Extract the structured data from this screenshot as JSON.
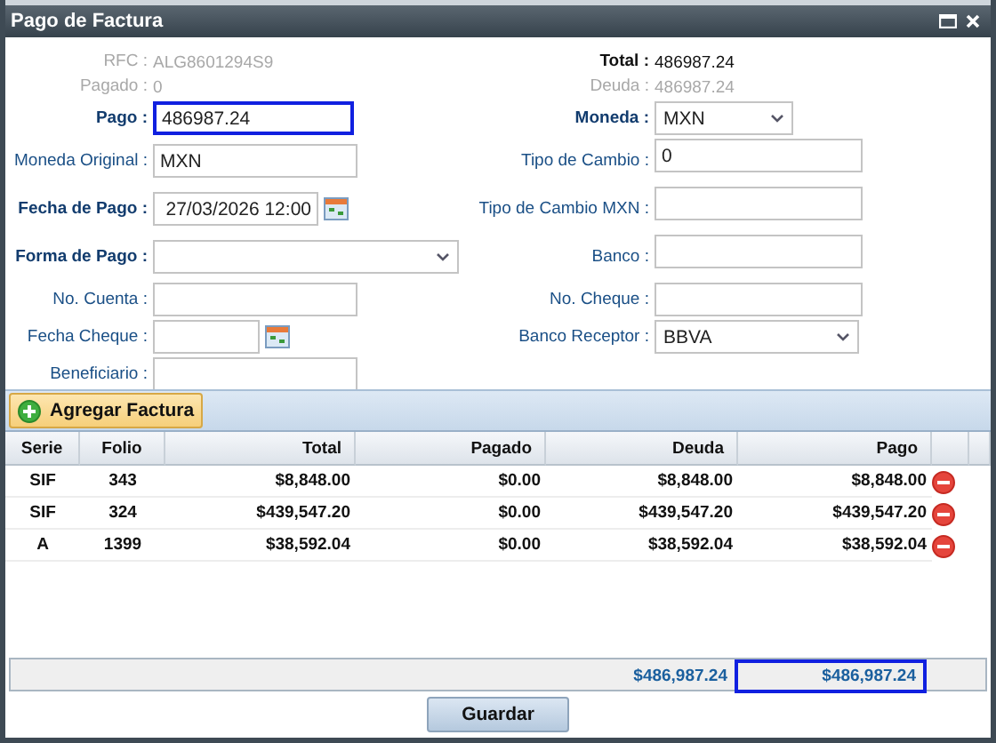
{
  "window": {
    "title": "Pago de Factura"
  },
  "form_rows": [
    {
      "left": {
        "label": "RFC :",
        "value": "ALG8601294S9",
        "kind": "static",
        "disabled": true,
        "required": false
      },
      "right": {
        "label": "Total :",
        "value": "486987.24",
        "kind": "static",
        "disabled": false,
        "required": true
      }
    },
    {
      "left": {
        "label": "Pagado :",
        "value": "0",
        "kind": "static",
        "disabled": true,
        "required": false
      },
      "right": {
        "label": "Deuda :",
        "value": "486987.24",
        "kind": "static",
        "disabled": true,
        "required": false
      }
    },
    {
      "left": {
        "label": "Pago :",
        "value": "486987.24",
        "kind": "input",
        "focused": true,
        "required": true
      },
      "right": {
        "label": "Moneda :",
        "value": "MXN",
        "kind": "select",
        "required": true
      }
    },
    {
      "left": {
        "label": "Moneda Original :",
        "value": "MXN",
        "kind": "input",
        "focused": false,
        "required": false
      },
      "right": {
        "label": "Tipo de Cambio :",
        "value": "0",
        "kind": "input",
        "focused": false,
        "required": false
      }
    },
    {
      "left": {
        "label": "Fecha de Pago :",
        "value": "27/03/2026 12:00",
        "kind": "date",
        "required": true
      },
      "right": {
        "label": "Tipo de Cambio MXN :",
        "kind": "input",
        "focused": false,
        "required": false
      }
    },
    {
      "left": {
        "label": "Forma de Pago :",
        "kind": "select",
        "required": true
      },
      "right": {
        "label": "Banco :",
        "kind": "input",
        "focused": false,
        "required": false
      }
    },
    {
      "left": {
        "label": "No. Cuenta :",
        "kind": "input",
        "focused": false,
        "required": false
      },
      "right": {
        "label": "No. Cheque :",
        "kind": "input",
        "focused": false,
        "required": false
      }
    },
    {
      "left": {
        "label": "Fecha Cheque :",
        "kind": "date",
        "required": false
      },
      "right": {
        "label": "Banco Receptor :",
        "value": "BBVA",
        "kind": "select",
        "required": false
      }
    },
    {
      "left": {
        "label": "Beneficiario :",
        "kind": "input",
        "focused": false,
        "required": false
      }
    }
  ],
  "toolbar": {
    "add_button": "Agregar Factura"
  },
  "table": {
    "columns": [
      "Serie",
      "Folio",
      "Total",
      "Pagado",
      "Deuda",
      "Pago"
    ],
    "rows": [
      {
        "serie": "SIF",
        "folio": "343",
        "total": "$8,848.00",
        "pagado": "$0.00",
        "deuda": "$8,848.00",
        "pago": "$8,848.00"
      },
      {
        "serie": "SIF",
        "folio": "324",
        "total": "$439,547.20",
        "pagado": "$0.00",
        "deuda": "$439,547.20",
        "pago": "$439,547.20"
      },
      {
        "serie": "A",
        "folio": "1399",
        "total": "$38,592.04",
        "pagado": "$0.00",
        "deuda": "$38,592.04",
        "pago": "$38,592.04"
      }
    ],
    "summary": {
      "deuda": "$486,987.24",
      "pago": "$486,987.24"
    }
  },
  "save_button": "Guardar"
}
